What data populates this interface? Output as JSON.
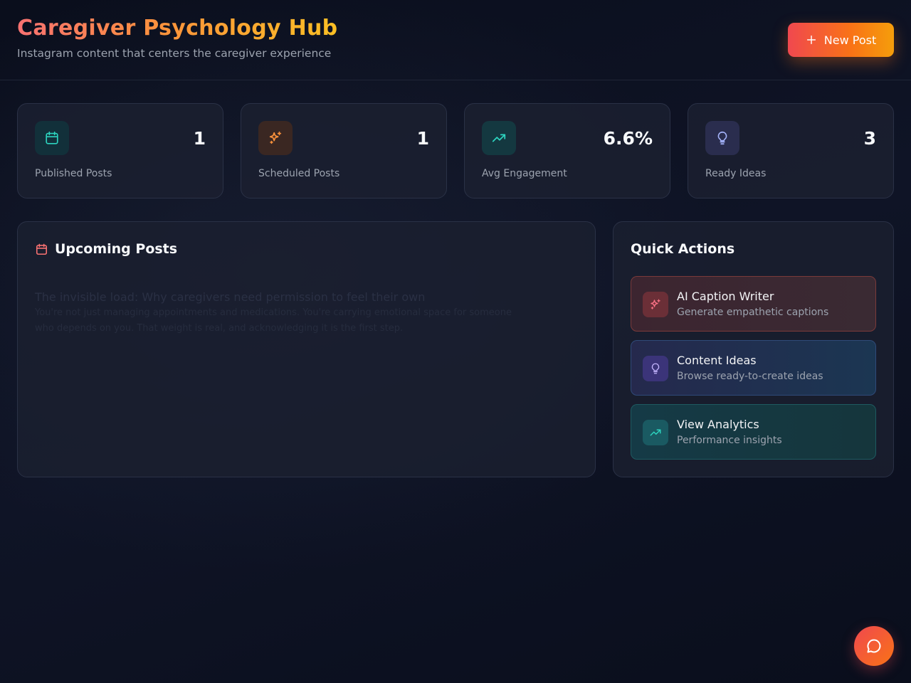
{
  "header": {
    "title": "Caregiver Psychology Hub",
    "subtitle": "Instagram content that centers the caregiver experience",
    "new_post_label": "New Post"
  },
  "stats": [
    {
      "icon": "calendar-icon",
      "value": "1",
      "label": "Published Posts",
      "color": "#2dd4bf"
    },
    {
      "icon": "sparkles-icon",
      "value": "1",
      "label": "Scheduled Posts",
      "color": "#fb923c"
    },
    {
      "icon": "trending-up-icon",
      "value": "6.6%",
      "label": "Avg Engagement",
      "color": "#2dd4bf"
    },
    {
      "icon": "lightbulb-icon",
      "value": "3",
      "label": "Ready Ideas",
      "color": "#a5b4fc"
    }
  ],
  "upcoming": {
    "title": "Upcoming Posts",
    "icon": "calendar-icon",
    "post_title": "The invisible load: Why caregivers need permission to feel their own",
    "post_body": "You're not just managing appointments and medications. You're carrying emotional space for someone who depends on you. That weight is real, and acknowledging it is the first step."
  },
  "quick_actions": {
    "title": "Quick Actions",
    "items": [
      {
        "icon": "sparkles-icon",
        "title": "AI Caption Writer",
        "description": "Generate empathetic captions"
      },
      {
        "icon": "lightbulb-icon",
        "title": "Content Ideas",
        "description": "Browse ready-to-create ideas"
      },
      {
        "icon": "trending-up-icon",
        "title": "View Analytics",
        "description": "Performance insights"
      }
    ]
  },
  "chat_fab": {
    "icon": "chat-bubble-icon"
  },
  "colors": {
    "accent_red": "#f0484f",
    "accent_orange": "#f97316",
    "teal": "#2dd4bf",
    "indigo": "#a5b4fc"
  }
}
